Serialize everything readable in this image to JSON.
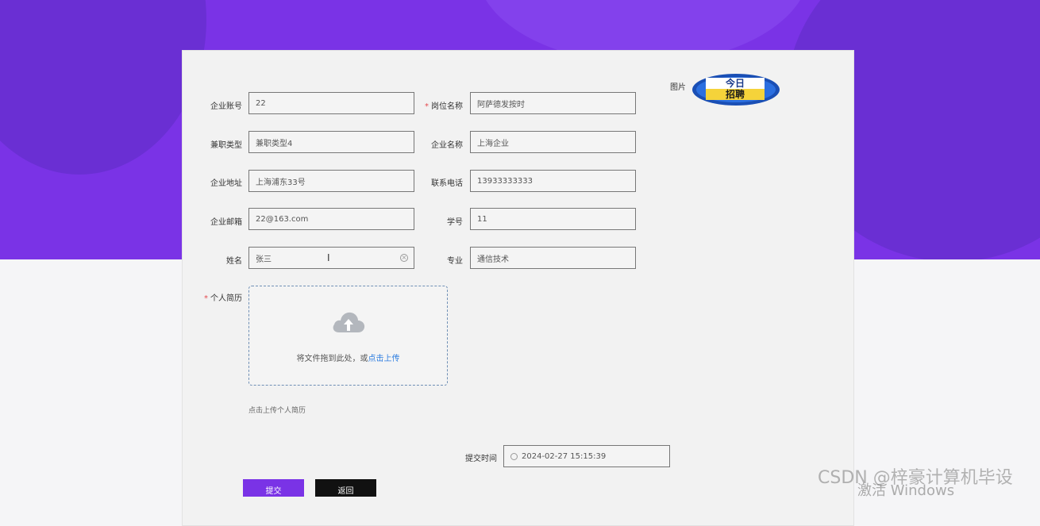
{
  "form": {
    "fields": [
      {
        "label": "企业账号",
        "value": "22",
        "required": false
      },
      {
        "label": "岗位名称",
        "value": "阿萨德发按时",
        "required": true
      },
      {
        "label": "兼职类型",
        "value": "兼职类型4",
        "required": false
      },
      {
        "label": "企业名称",
        "value": "上海企业",
        "required": false
      },
      {
        "label": "企业地址",
        "value": "上海浦东33号",
        "required": false
      },
      {
        "label": "联系电话",
        "value": "13933333333",
        "required": false
      },
      {
        "label": "企业邮箱",
        "value": "22@163.com",
        "required": false
      },
      {
        "label": "学号",
        "value": "11",
        "required": false
      },
      {
        "label": "姓名",
        "value": "张三",
        "required": false
      },
      {
        "label": "专业",
        "value": "通信技术",
        "required": false
      }
    ],
    "image_label": "图片",
    "resume": {
      "label": "个人简历",
      "required": true,
      "hint_prefix": "将文件拖到此处，或",
      "hint_link": "点击上传",
      "tip": "点击上传个人简历"
    },
    "submit_time": {
      "label": "提交时间",
      "value": "2024-02-27 15:15:39"
    },
    "buttons": {
      "submit": "提交",
      "back": "返回"
    }
  },
  "logo": {
    "line1": "今日",
    "line2": "招聘"
  },
  "watermarks": {
    "csdn": "CSDN @梓豪计算机毕设",
    "windows": "激活 Windows"
  },
  "colors": {
    "accent": "#7a33e6",
    "link": "#2d7de0",
    "required": "#e5484d"
  }
}
